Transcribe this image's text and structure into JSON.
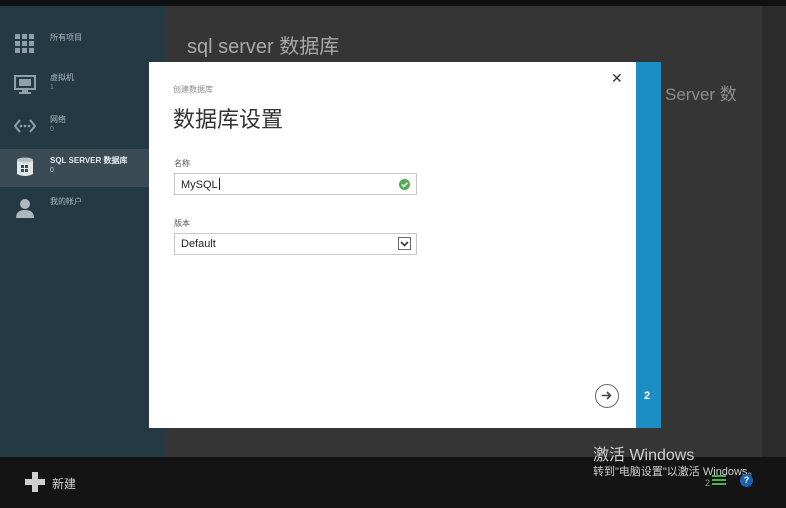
{
  "sidebar": {
    "items": [
      {
        "label": "所有项目",
        "count": "",
        "icon": "all-items-icon"
      },
      {
        "label": "虚拟机",
        "count": "1",
        "icon": "virtual-machine-icon"
      },
      {
        "label": "网络",
        "count": "0",
        "icon": "network-icon"
      },
      {
        "label": "SQL SERVER 数据库",
        "count": "0",
        "icon": "database-icon"
      },
      {
        "label": "我的帐户",
        "count": "",
        "icon": "account-icon"
      }
    ]
  },
  "main": {
    "title": "sql server 数据库",
    "background_text": "Server 数"
  },
  "dialog": {
    "subtitle": "创建数据库",
    "title": "数据库设置",
    "name_label": "名称",
    "name_value": "MySQL",
    "version_label": "版本",
    "version_value": "Default",
    "step": "2"
  },
  "bottombar": {
    "new_label": "新建",
    "count": "2"
  },
  "watermark": {
    "line1": "激活 Windows",
    "line2": "转到\"电脑设置\"以激活 Windows。"
  },
  "colors": {
    "accent": "#1b8fc3",
    "sidebar": "#233a45",
    "ok": "#4caf50"
  }
}
